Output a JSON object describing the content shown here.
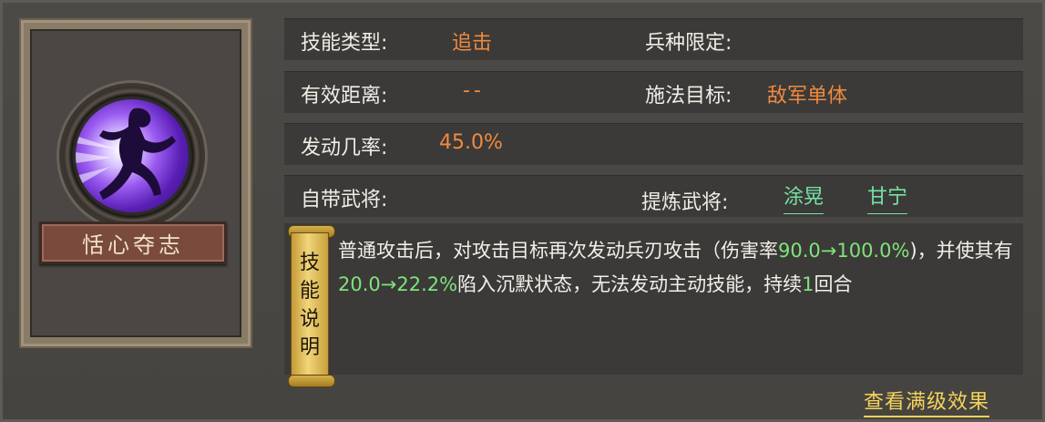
{
  "skill": {
    "name": "恬心夺志"
  },
  "rows": {
    "type_label": "技能类型:",
    "type_value": "追击",
    "troop_label": "兵种限定:",
    "range_label": "有效距离:",
    "range_value": "--",
    "target_label": "施法目标:",
    "target_value": "敌军单体",
    "rate_label": "发动几率:",
    "rate_value": "45.0%",
    "own_label": "自带武将:",
    "refine_label": "提炼武将:",
    "refine_officers": [
      "涂晃",
      "甘宁"
    ]
  },
  "scroll": {
    "chars": [
      "技",
      "能",
      "说",
      "明"
    ]
  },
  "description": {
    "t1": "普通攻击后，对攻击目标再次发动兵刃攻击（伤害率",
    "g1": "90.0→100.0%",
    "t2": ")，并使其有",
    "g2": "20.0→22.2%",
    "t3": "陷入沉默状态，无法发动主动技能，持续",
    "g3": "1",
    "t4": "回合"
  },
  "footer": {
    "full_level_link": "查看满级效果"
  },
  "colors": {
    "orange": "#f08a40",
    "green": "#7fe37a",
    "officer_green": "#74e3a4",
    "link_yellow": "#f5d35a"
  }
}
